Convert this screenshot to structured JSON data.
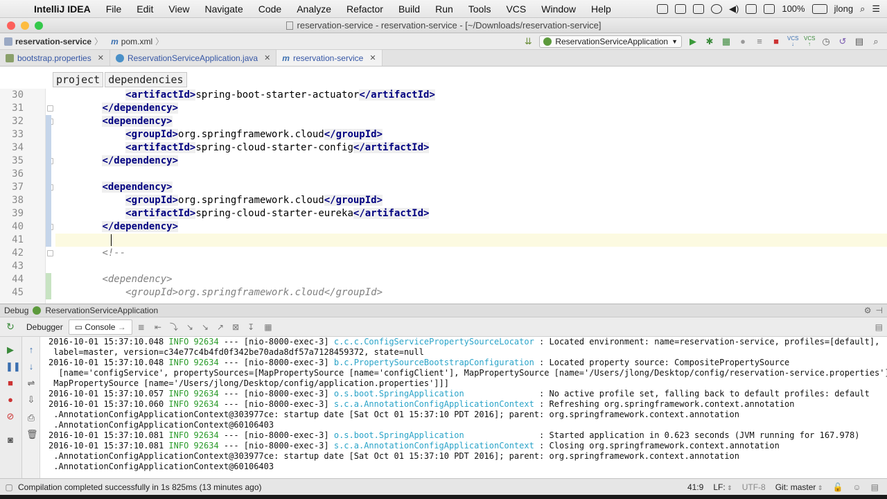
{
  "menubar": {
    "app": "IntelliJ IDEA",
    "items": [
      "File",
      "Edit",
      "View",
      "Navigate",
      "Code",
      "Analyze",
      "Refactor",
      "Build",
      "Run",
      "Tools",
      "VCS",
      "Window",
      "Help"
    ],
    "battery": "100%",
    "user": "jlong"
  },
  "window": {
    "title": "reservation-service - reservation-service - [~/Downloads/reservation-service]"
  },
  "toolbar": {
    "crumb_project": "reservation-service",
    "crumb_file": "pom.xml",
    "run_config": "ReservationServiceApplication",
    "vcs": "VCS"
  },
  "tabs": [
    {
      "label": "bootstrap.properties"
    },
    {
      "label": "ReservationServiceApplication.java"
    },
    {
      "label": "reservation-service"
    }
  ],
  "editor": {
    "path_tags": [
      "project",
      "dependencies"
    ],
    "lines": [
      {
        "n": "30",
        "pre": "            ",
        "tag1": "<artifactId>",
        "text": "spring-boot-starter-actuator",
        "tag2": "</artifactId>"
      },
      {
        "n": "31",
        "pre": "        ",
        "tag1": "</dependency>",
        "text": "",
        "tag2": ""
      },
      {
        "n": "32",
        "pre": "        ",
        "tag1": "<dependency>",
        "text": "",
        "tag2": ""
      },
      {
        "n": "33",
        "pre": "            ",
        "tag1": "<groupId>",
        "text": "org.springframework.cloud",
        "tag2": "</groupId>"
      },
      {
        "n": "34",
        "pre": "            ",
        "tag1": "<artifactId>",
        "text": "spring-cloud-starter-config",
        "tag2": "</artifactId>"
      },
      {
        "n": "35",
        "pre": "        ",
        "tag1": "</dependency>",
        "text": "",
        "tag2": ""
      },
      {
        "n": "36",
        "pre": "",
        "tag1": "",
        "text": "",
        "tag2": ""
      },
      {
        "n": "37",
        "pre": "        ",
        "tag1": "<dependency>",
        "text": "",
        "tag2": ""
      },
      {
        "n": "38",
        "pre": "            ",
        "tag1": "<groupId>",
        "text": "org.springframework.cloud",
        "tag2": "</groupId>"
      },
      {
        "n": "39",
        "pre": "            ",
        "tag1": "<artifactId>",
        "text": "spring-cloud-starter-eureka",
        "tag2": "</artifactId>"
      },
      {
        "n": "40",
        "pre": "        ",
        "tag1": "</dependency>",
        "text": "",
        "tag2": ""
      },
      {
        "n": "41",
        "pre": "",
        "tag1": "",
        "text": "",
        "tag2": ""
      },
      {
        "n": "42",
        "pre": "        ",
        "comment": "<!--"
      },
      {
        "n": "43",
        "pre": "",
        "tag1": "",
        "text": "",
        "tag2": ""
      },
      {
        "n": "44",
        "pre": "        ",
        "comment": "<dependency>"
      },
      {
        "n": "45",
        "pre": "            ",
        "comment": "<groupId>org.springframework.cloud</groupId>"
      }
    ]
  },
  "debug": {
    "label": "Debug",
    "config": "ReservationServiceApplication",
    "tabs": [
      "Debugger",
      "Console"
    ]
  },
  "console": {
    "lines": [
      {
        "ts": "2016-10-01 15:37:10.048",
        "lvl": "INFO",
        "pid": "92634",
        "thr": " --- [nio-8000-exec-3] ",
        "cls": "c.c.c.ConfigServicePropertySourceLocator",
        "msg": " : Located environment: name=reservation-service, profiles=[default],"
      },
      {
        "cont": " label=master, version=c34e77c4b4fd0f342be70ada8df57a7128459372, state=null"
      },
      {
        "ts": "2016-10-01 15:37:10.048",
        "lvl": "INFO",
        "pid": "92634",
        "thr": " --- [nio-8000-exec-3] ",
        "cls": "b.c.PropertySourceBootstrapConfiguration",
        "msg": " : Located property source: CompositePropertySource"
      },
      {
        "cont": "  [name='configService', propertySources=[MapPropertySource [name='configClient'], MapPropertySource [name='/Users/jlong/Desktop/config/reservation-service.properties'],"
      },
      {
        "cont": " MapPropertySource [name='/Users/jlong/Desktop/config/application.properties']]]"
      },
      {
        "ts": "2016-10-01 15:37:10.057",
        "lvl": "INFO",
        "pid": "92634",
        "thr": " --- [nio-8000-exec-3] ",
        "cls": "o.s.boot.SpringApplication              ",
        "msg": " : No active profile set, falling back to default profiles: default"
      },
      {
        "ts": "2016-10-01 15:37:10.060",
        "lvl": "INFO",
        "pid": "92634",
        "thr": " --- [nio-8000-exec-3] ",
        "cls": "s.c.a.AnnotationConfigApplicationContext",
        "msg": " : Refreshing org.springframework.context.annotation"
      },
      {
        "cont": " .AnnotationConfigApplicationContext@303977ce: startup date [Sat Oct 01 15:37:10 PDT 2016]; parent: org.springframework.context.annotation"
      },
      {
        "cont": " .AnnotationConfigApplicationContext@60106403"
      },
      {
        "ts": "2016-10-01 15:37:10.081",
        "lvl": "INFO",
        "pid": "92634",
        "thr": " --- [nio-8000-exec-3] ",
        "cls": "o.s.boot.SpringApplication              ",
        "msg": " : Started application in 0.623 seconds (JVM running for 167.978)"
      },
      {
        "ts": "2016-10-01 15:37:10.081",
        "lvl": "INFO",
        "pid": "92634",
        "thr": " --- [nio-8000-exec-3] ",
        "cls": "s.c.a.AnnotationConfigApplicationContext",
        "msg": " : Closing org.springframework.context.annotation"
      },
      {
        "cont": " .AnnotationConfigApplicationContext@303977ce: startup date [Sat Oct 01 15:37:10 PDT 2016]; parent: org.springframework.context.annotation"
      },
      {
        "cont": " .AnnotationConfigApplicationContext@60106403"
      }
    ]
  },
  "status": {
    "message": "Compilation completed successfully in 1s 825ms (13 minutes ago)",
    "position": "41:9",
    "line_sep": "LF:",
    "encoding": "UTF-8",
    "git": "Git: master"
  }
}
